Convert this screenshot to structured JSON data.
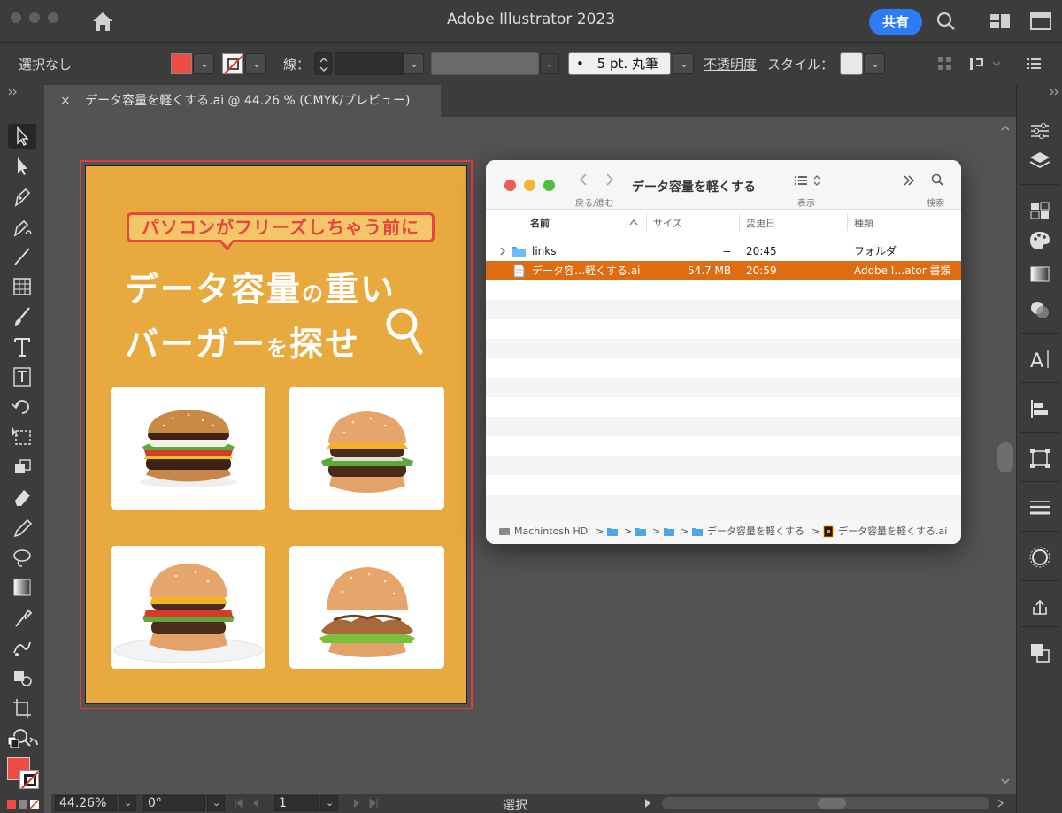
{
  "app": {
    "title": "Adobe Illustrator 2023",
    "share_label": "共有",
    "icons": [
      "home-icon",
      "search-icon",
      "workspace-icon",
      "panel-toggle-icon"
    ]
  },
  "control_bar": {
    "selection_label": "選択なし",
    "stroke_label": "線：",
    "brush_dot": "•",
    "brush_value": "5 pt. 丸筆",
    "opacity_label": "不透明度",
    "style_label": "スタイル："
  },
  "document_tab": {
    "close": "×",
    "title": "データ容量を軽くする.ai @ 44.26 % (CMYK/プレビュー)"
  },
  "artboard": {
    "bubble_text": "パソコンがフリーズしちゃう前に",
    "headline_line1_main": "データ容量",
    "headline_line1_small": "の",
    "headline_line1_end": "重い",
    "headline_line2_main": "バーガー",
    "headline_line2_small": "を",
    "headline_line2_end": "探せ",
    "background_color": "#e8a93f",
    "accent_color": "#e8453c"
  },
  "finder": {
    "title": "データ容量を軽くする",
    "nav_label": "戻る/進む",
    "view_label": "表示",
    "search_label": "検索",
    "columns": [
      "名前",
      "サイズ",
      "変更日",
      "種類"
    ],
    "rows": [
      {
        "name": "links",
        "size": "--",
        "date": "20:45",
        "kind": "フォルダ"
      },
      {
        "name": "データ容…軽くする.ai",
        "size": "54.7 MB",
        "date": "20:59",
        "kind": "Adobe I…ator 書類"
      }
    ],
    "path": {
      "disk": "Machintosh HD",
      "sep": ">",
      "folder": "データ容量を軽くする",
      "file": "データ容量を軽くする.ai"
    }
  },
  "status_bar": {
    "zoom": "44.26%",
    "rotation": "0°",
    "page": "1",
    "mode": "選択"
  }
}
